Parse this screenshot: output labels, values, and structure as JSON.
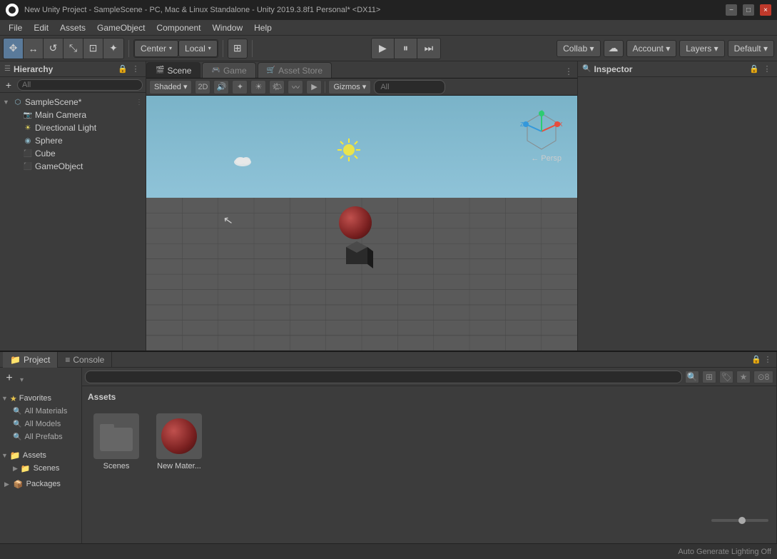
{
  "titlebar": {
    "title": "New Unity Project - SampleScene - PC, Mac & Linux Standalone - Unity 2019.3.8f1 Personal* <DX11>",
    "minimize_label": "−",
    "maximize_label": "□",
    "close_label": "×"
  },
  "menubar": {
    "items": [
      "File",
      "Edit",
      "Assets",
      "GameObject",
      "Component",
      "Window",
      "Help"
    ]
  },
  "toolbar": {
    "tools": [
      "⊹",
      "↔",
      "↺",
      "⊡",
      "⟳",
      "✦"
    ],
    "pivot_label": "Center",
    "space_label": "Local",
    "rect_label": "⊞",
    "play_label": "▶",
    "pause_label": "⏸",
    "step_label": "⏭",
    "collab_label": "Collab ▾",
    "cloud_label": "☁",
    "account_label": "Account ▾",
    "layers_label": "Layers ▾",
    "layout_label": "Default ▾"
  },
  "hierarchy": {
    "panel_title": "Hierarchy",
    "search_placeholder": "All",
    "items": [
      {
        "label": "SampleScene*",
        "type": "scene",
        "depth": 0,
        "has_arrow": true,
        "has_kebab": true
      },
      {
        "label": "Main Camera",
        "type": "camera",
        "depth": 1,
        "has_arrow": false
      },
      {
        "label": "Directional Light",
        "type": "light",
        "depth": 1,
        "has_arrow": false
      },
      {
        "label": "Sphere",
        "type": "object",
        "depth": 1,
        "has_arrow": false
      },
      {
        "label": "Cube",
        "type": "object",
        "depth": 1,
        "has_arrow": false
      },
      {
        "label": "GameObject",
        "type": "object",
        "depth": 1,
        "has_arrow": false
      }
    ]
  },
  "scene": {
    "tabs": [
      {
        "label": "Scene",
        "icon": "🎬",
        "active": true
      },
      {
        "label": "Game",
        "icon": "🎮",
        "active": false
      },
      {
        "label": "Asset Store",
        "icon": "🛒",
        "active": false
      }
    ],
    "shading_mode": "Shaded",
    "perspective": "← Persp",
    "gizmos_label": "Gizmos ▾",
    "search_placeholder": "All",
    "toolbar_2d": "2D",
    "toolbar_sound": "🔊",
    "toolbar_fx": "✦",
    "toolbar_grid": "⊞"
  },
  "inspector": {
    "panel_title": "Inspector"
  },
  "project": {
    "tabs": [
      {
        "label": "Project",
        "icon": "📁",
        "active": true
      },
      {
        "label": "Console",
        "icon": "≡",
        "active": false
      }
    ],
    "favorites": {
      "label": "Favorites",
      "items": [
        "All Materials",
        "All Models",
        "All Prefabs"
      ]
    },
    "assets_section": {
      "label": "Assets",
      "sub_items": [
        "Scenes"
      ]
    },
    "packages_label": "Packages",
    "main_assets_header": "Assets",
    "assets": [
      {
        "name": "Scenes",
        "type": "folder"
      },
      {
        "name": "New Mater...",
        "type": "sphere"
      }
    ],
    "search_placeholder": ""
  },
  "statusbar": {
    "text": "Auto Generate Lighting Off"
  }
}
